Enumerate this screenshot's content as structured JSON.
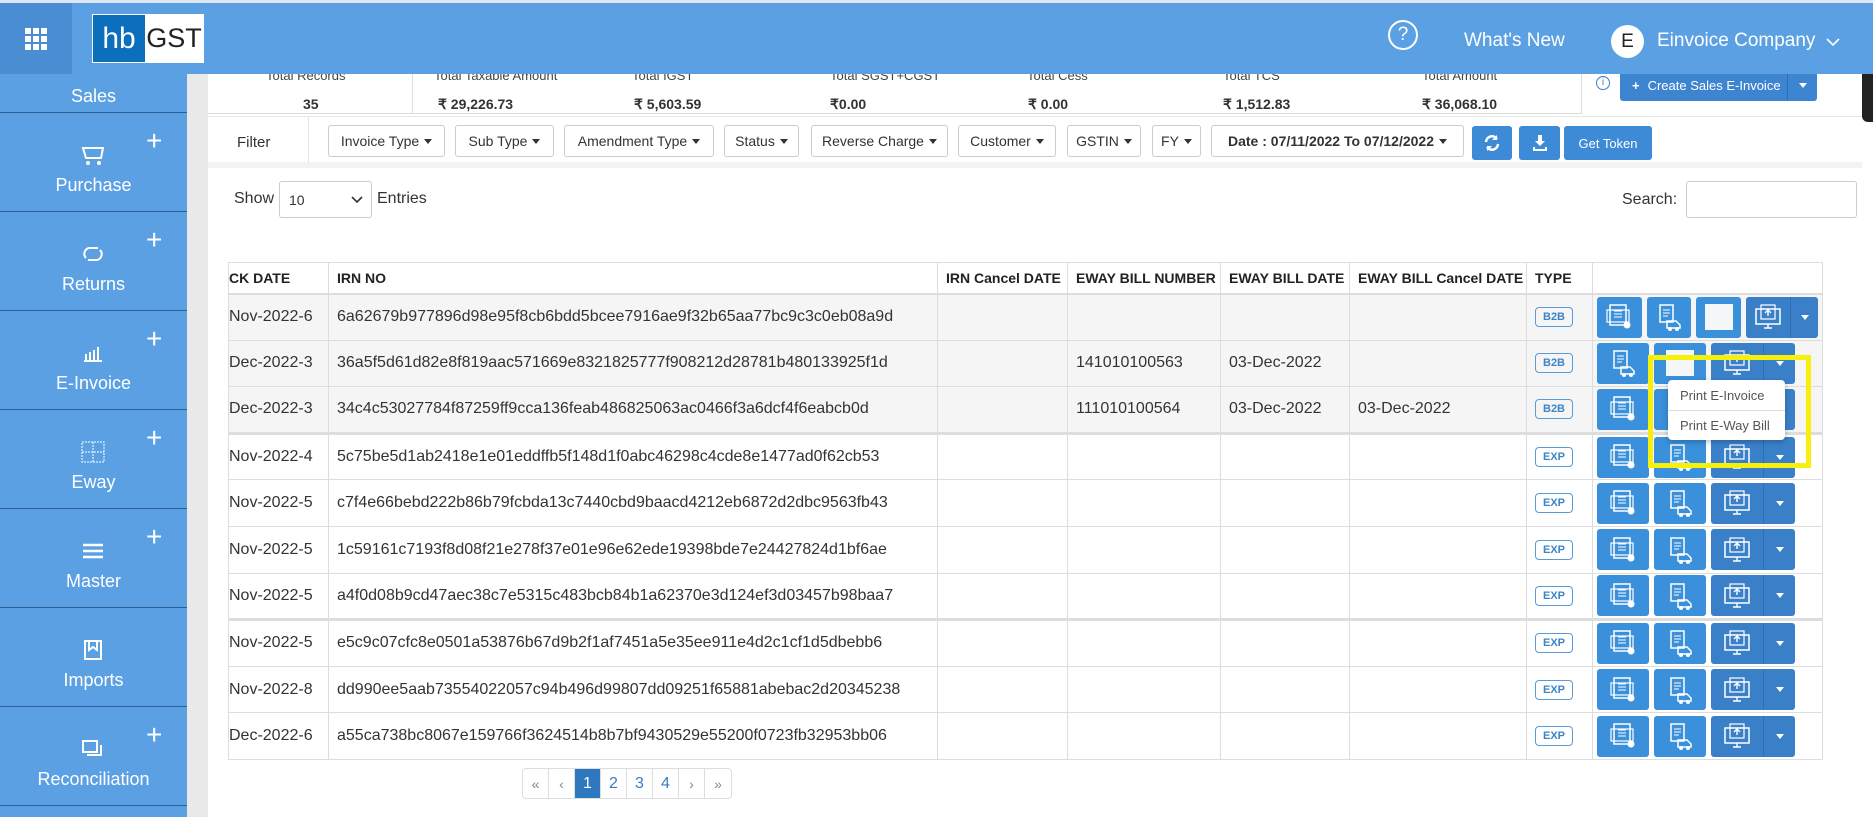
{
  "header": {
    "logo_hb": "hb",
    "logo_gst": "GST",
    "whats_new": "What's New",
    "user_initial": "E",
    "user_name": "Einvoice Company"
  },
  "sidebar": {
    "items": [
      {
        "label": "Sales"
      },
      {
        "label": "Purchase",
        "icon": "cart-icon"
      },
      {
        "label": "Returns",
        "icon": "repeat-icon"
      },
      {
        "label": "E-Invoice",
        "icon": "bar-chart-icon"
      },
      {
        "label": "Eway",
        "icon": "grid-icon"
      },
      {
        "label": "Master",
        "icon": "menu-icon"
      },
      {
        "label": "Imports",
        "icon": "bookmark-icon"
      },
      {
        "label": "Reconciliation",
        "icon": "windows-icon"
      }
    ]
  },
  "summary": [
    {
      "label": "Total Records",
      "value": "35"
    },
    {
      "label": "Total Taxable Amount",
      "value": "₹ 29,226.73"
    },
    {
      "label": "Total IGST",
      "value": "₹ 5,603.59"
    },
    {
      "label": "Total SGST+CGST",
      "value": "₹0.00"
    },
    {
      "label": "Total Cess",
      "value": "₹ 0.00"
    },
    {
      "label": "Total TCS",
      "value": "₹ 1,512.83"
    },
    {
      "label": "Total Amount",
      "value": "₹ 36,068.10"
    }
  ],
  "create_button": "Create Sales E-Invoice",
  "filter": {
    "label": "Filter",
    "buttons": [
      "Invoice Type",
      "Sub Type",
      "Amendment Type",
      "Status",
      "Reverse Charge",
      "Customer",
      "GSTIN",
      "FY",
      "Date : 07/11/2022 To 07/12/2022"
    ],
    "get_token": "Get Token"
  },
  "entries": {
    "show": "Show",
    "value": "10",
    "suffix": "Entries",
    "search_label": "Search:",
    "search_value": ""
  },
  "table": {
    "headers": [
      "CK DATE",
      "IRN NO",
      "IRN Cancel DATE",
      "EWAY BILL NUMBER",
      "EWAY BILL DATE",
      "EWAY BILL Cancel DATE",
      "TYPE",
      ""
    ],
    "rows": [
      [
        "6-Nov-2022",
        "6a62679b977896d98e95f8cb6bdd5bcee7916ae9f32b65aa77bc9c3c0eb08a9d",
        "",
        "",
        "",
        "",
        "B2B"
      ],
      [
        "3-Dec-2022",
        "36a5f5d61d82e8f819aac571669e8321825777f908212d28781b480133925f1d",
        "",
        "141010100563",
        "03-Dec-2022",
        "",
        "B2B"
      ],
      [
        "3-Dec-2022",
        "34c4c53027784f87259ff9cca136feab486825063ac0466f3a6dcf4f6eabcb0d",
        "",
        "111010100564",
        "03-Dec-2022",
        "03-Dec-2022",
        "B2B"
      ],
      [
        "4-Nov-2022",
        "5c75be5d1ab2418e1e01eddffb5f148d1f0abc46298c4cde8e1477ad0f62cb53",
        "",
        "",
        "",
        "",
        "EXP"
      ],
      [
        "5-Nov-2022",
        "c7f4e66bebd222b86b79fcbda13c7440cbd9baacd4212eb6872d2dbc9563fb43",
        "",
        "",
        "",
        "",
        "EXP"
      ],
      [
        "5-Nov-2022",
        "1c59161c7193f8d08f21e278f37e01e96e62ede19398bde7e24427824d1bf6ae",
        "",
        "",
        "",
        "",
        "EXP"
      ],
      [
        "5-Nov-2022",
        "a4f0d08b9cd47aec38c7e5315c483bcb84b1a62370e3d124ef3d03457b98baa7",
        "",
        "",
        "",
        "",
        "EXP"
      ],
      [
        "5-Nov-2022",
        "e5c9c07cfc8e0501a53876b67d9b2f1af7451a5e35ee911e4d2c1cf1d5dbebb6",
        "",
        "",
        "",
        "",
        "EXP"
      ],
      [
        "8-Nov-2022",
        "dd990ee5aab73554022057c94b496d99807dd09251f65881abebac2d20345238",
        "",
        "",
        "",
        "",
        "EXP"
      ],
      [
        "6-Dec-2022",
        "a55ca738bc8067e159766f3624514b8b7bf9430529e55200f0723fb32953bb06",
        "",
        "",
        "",
        "",
        "EXP"
      ]
    ]
  },
  "dropdown_menu": [
    "Print E-Invoice",
    "Print E-Way Bill"
  ],
  "pagination": {
    "first": "«",
    "prev": "‹",
    "pages": [
      "1",
      "2",
      "3",
      "4"
    ],
    "current": "1",
    "next": "›",
    "last": "»"
  },
  "colors": {
    "brand": "#5ca0e4",
    "button": "#3a90db",
    "highlight": "#f7ef0c"
  }
}
